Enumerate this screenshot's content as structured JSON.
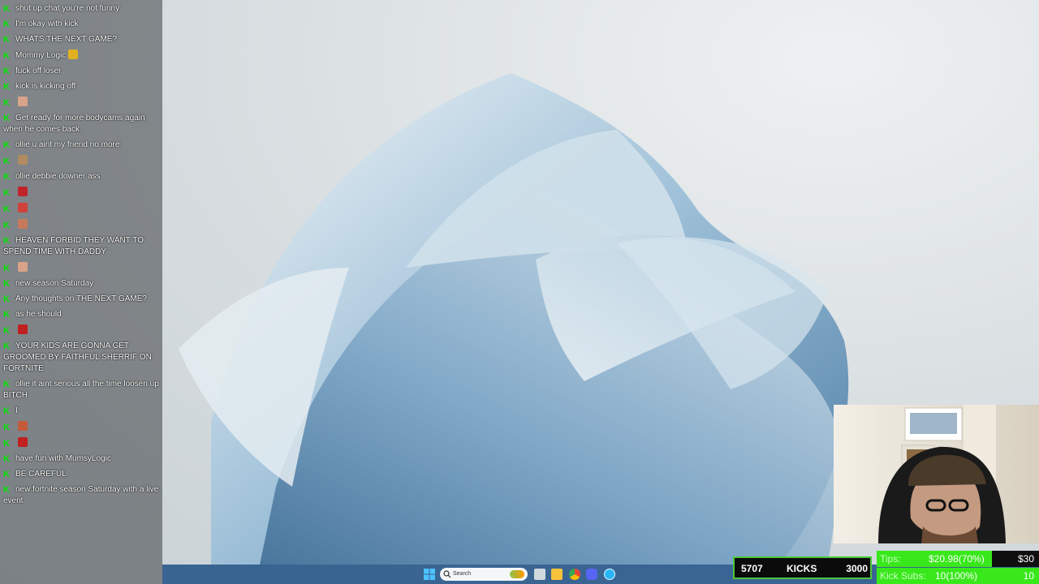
{
  "chat": {
    "messages": [
      {
        "user": "",
        "text": "shut up chat you're not funny"
      },
      {
        "user": "",
        "text": "I'm okay with kick"
      },
      {
        "user": "",
        "text": "WHATS THE NEXT GAME?"
      },
      {
        "user": "",
        "text": "Mommy Logic"
      },
      {
        "user": "",
        "text": "fuck off loser"
      },
      {
        "user": "",
        "text": "kick is kicking off"
      },
      {
        "user": "",
        "text": ""
      },
      {
        "user": "",
        "text": "Get ready for more bodycams again when he comes back."
      },
      {
        "user": "",
        "text": "ollie u aint my friend no more"
      },
      {
        "user": "",
        "text": ""
      },
      {
        "user": "",
        "text": "ollie debbie downer ass"
      },
      {
        "user": "",
        "text": ""
      },
      {
        "user": "",
        "text": ""
      },
      {
        "user": "",
        "text": ""
      },
      {
        "user": "",
        "text": "HEAVEN FORBID THEY WANT TO SPEND TIME WITH DADDY"
      },
      {
        "user": "",
        "text": ""
      },
      {
        "user": "",
        "text": "new season Saturday"
      },
      {
        "user": "",
        "text": "Any thoughts on THE NEXT GAME?"
      },
      {
        "user": "",
        "text": "as he should"
      },
      {
        "user": "",
        "text": ""
      },
      {
        "user": "",
        "text": "YOUR KIDS ARE GONNA GET GROOMED BY FAITHFUL SHERRIF ON FORTNITE"
      },
      {
        "user": "",
        "text": "ollie it aint serious all the time loosen up BITCH"
      },
      {
        "user": "",
        "text": "I"
      },
      {
        "user": "",
        "text": ""
      },
      {
        "user": "",
        "text": ""
      },
      {
        "user": "",
        "text": "have fun with MumsyLogic"
      },
      {
        "user": "",
        "text": "BE CAREFUL"
      },
      {
        "user": "",
        "text": "new fortnite season Saturday with a live event"
      }
    ]
  },
  "taskbar": {
    "search_label": "Search"
  },
  "kicks": {
    "current": "5707",
    "label": "KICKS",
    "goal": "3000"
  },
  "tips": {
    "tips_label": "Tips:",
    "tips_value": "$20.98(70%)",
    "tips_goal": "$30",
    "subs_label": "Kick Subs:",
    "subs_value": "10(100%)",
    "subs_goal": "10"
  },
  "colors": {
    "kick_green": "#00e701",
    "username_blue": "#5d6cff",
    "taskbar": "#2c5a8c",
    "panel_green": "#39e81b"
  }
}
